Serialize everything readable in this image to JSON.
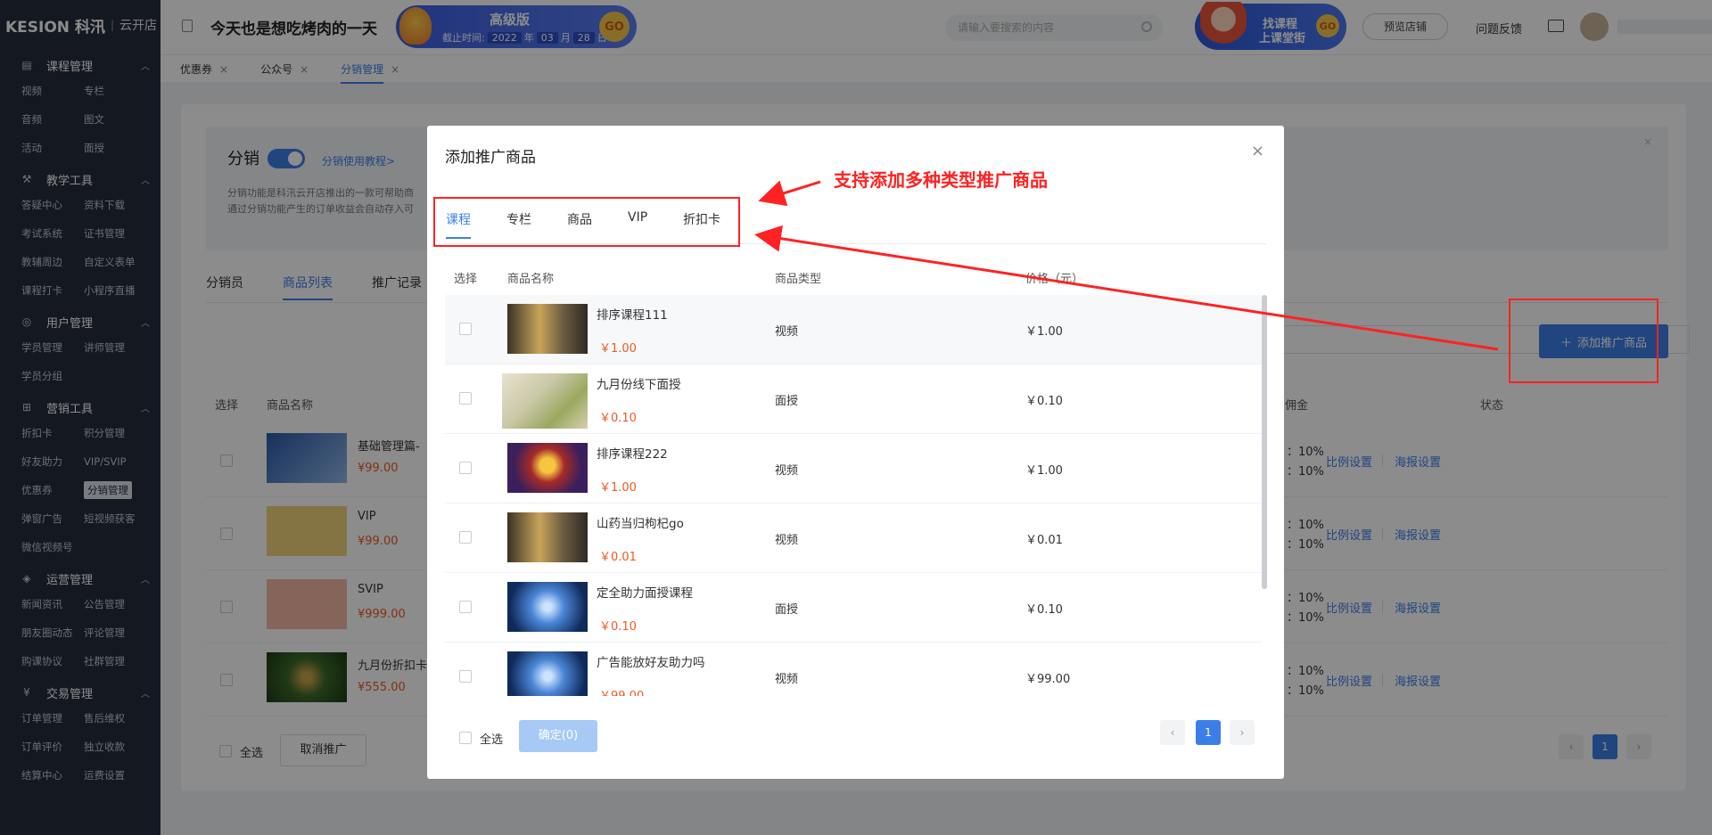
{
  "brand": {
    "logo": "KESION 科汛",
    "store": "云开店"
  },
  "sidebar": {
    "groups": [
      {
        "title": "课程管理",
        "icon": "book-icon",
        "items": [
          "视频",
          "专栏",
          "音频",
          "图文",
          "活动",
          "面授"
        ]
      },
      {
        "title": "教学工具",
        "icon": "tools-icon",
        "items": [
          "答疑中心",
          "资料下载",
          "考试系统",
          "证书管理",
          "教辅周边",
          "自定义表单",
          "课程打卡",
          "小程序直播"
        ]
      },
      {
        "title": "用户管理",
        "icon": "user-icon",
        "items": [
          "学员管理",
          "讲师管理",
          "学员分组"
        ]
      },
      {
        "title": "营销工具",
        "icon": "gift-icon",
        "items": [
          "折扣卡",
          "积分管理",
          "好友助力",
          "VIP/SVIP",
          "优惠券",
          "分销管理",
          "弹窗广告",
          "短视频获客",
          "微信视频号"
        ]
      },
      {
        "title": "运营管理",
        "icon": "layers-icon",
        "items": [
          "新闻资讯",
          "公告管理",
          "朋友圈动态",
          "评论管理",
          "购课协议",
          "社群管理"
        ]
      },
      {
        "title": "交易管理",
        "icon": "yen-icon",
        "items": [
          "订单管理",
          "售后维权",
          "订单评价",
          "独立收款",
          "结算中心",
          "运费设置"
        ]
      }
    ],
    "active_item": "分销管理"
  },
  "topbar": {
    "shop_title": "今天也是想吃烤肉的一天",
    "vip": {
      "level": "高级版",
      "expire_label": "截止时间:",
      "year": "2022",
      "y": "年",
      "month": "03",
      "m": "月",
      "day": "28",
      "d": "日",
      "go": "GO"
    },
    "search_placeholder": "请输入要搜索的内容",
    "promo": {
      "line1": "找课程",
      "line2": "上课堂街",
      "go": "GO"
    },
    "preview_button": "预览店铺",
    "feedback": "问题反馈"
  },
  "page_tabs": [
    {
      "label": "优惠券",
      "close": "×"
    },
    {
      "label": "公众号",
      "close": "×"
    },
    {
      "label": "分销管理",
      "close": "×",
      "active": true
    }
  ],
  "info": {
    "title": "分销",
    "toggle_on": true,
    "link": "分销使用教程>",
    "desc1": "分销功能是科汛云开店推出的一款可帮助商",
    "desc2": "通过分销功能产生的订单收益会自动存入可",
    "close": "×"
  },
  "subtabs": [
    "分销员",
    "商品列表",
    "推广记录"
  ],
  "add_button": "添加推广商品",
  "bg_table": {
    "headers": {
      "select": "选择",
      "name": "商品名称",
      "commission": "佣金",
      "status": "状态"
    },
    "rows": [
      {
        "name": "基础管理篇-",
        "price": "¥99.00",
        "r1": "：10%",
        "r2": "：10%",
        "a1": "比例设置",
        "a2": "海报设置"
      },
      {
        "name": "VIP",
        "price": "¥99.00",
        "r1": "：10%",
        "r2": "：10%",
        "a1": "比例设置",
        "a2": "海报设置"
      },
      {
        "name": "SVIP",
        "price": "¥999.00",
        "r1": "：10%",
        "r2": "：10%",
        "a1": "比例设置",
        "a2": "海报设置"
      },
      {
        "name": "九月份折扣卡",
        "price": "¥555.00",
        "r1": "：10%",
        "r2": "：10%",
        "a1": "比例设置",
        "a2": "海报设置"
      }
    ],
    "select_all": "全选",
    "cancel_button": "取消推广",
    "page": "1"
  },
  "modal": {
    "title": "添加推广商品",
    "close": "×",
    "tabs": [
      "课程",
      "专栏",
      "商品",
      "VIP",
      "折扣卡"
    ],
    "active_tab": "课程",
    "headers": {
      "select": "选择",
      "name": "商品名称",
      "type": "商品类型",
      "price": "价格（元）"
    },
    "rows": [
      {
        "name": "排序课程111",
        "price": "￥1.00",
        "type": "视频",
        "amount": "￥1.00",
        "thumb": "building"
      },
      {
        "name": "九月份线下面授",
        "price": "￥0.10",
        "type": "面授",
        "amount": "￥0.10",
        "thumb": "blur"
      },
      {
        "name": "排序课程222",
        "price": "￥1.00",
        "type": "视频",
        "amount": "￥1.00",
        "thumb": "stage"
      },
      {
        "name": "山药当归枸杞go",
        "price": "￥0.01",
        "type": "视频",
        "amount": "￥0.01",
        "thumb": "building"
      },
      {
        "name": "定全助力面授课程",
        "price": "￥0.10",
        "type": "面授",
        "amount": "￥0.10",
        "thumb": "galaxy"
      },
      {
        "name": "广告能放好友助力吗",
        "price": "￥99.00",
        "type": "视频",
        "amount": "￥99.00",
        "thumb": "galaxy"
      }
    ],
    "select_all": "全选",
    "confirm": "确定(0)",
    "prev": "‹",
    "page": "1",
    "next": "›"
  },
  "annotation": "支持添加多种类型推广商品",
  "colors": {
    "accent": "#3c7ee8",
    "sidebar_bg": "#252d3d",
    "price": "#ee5a22",
    "annotation": "#ff2222"
  }
}
